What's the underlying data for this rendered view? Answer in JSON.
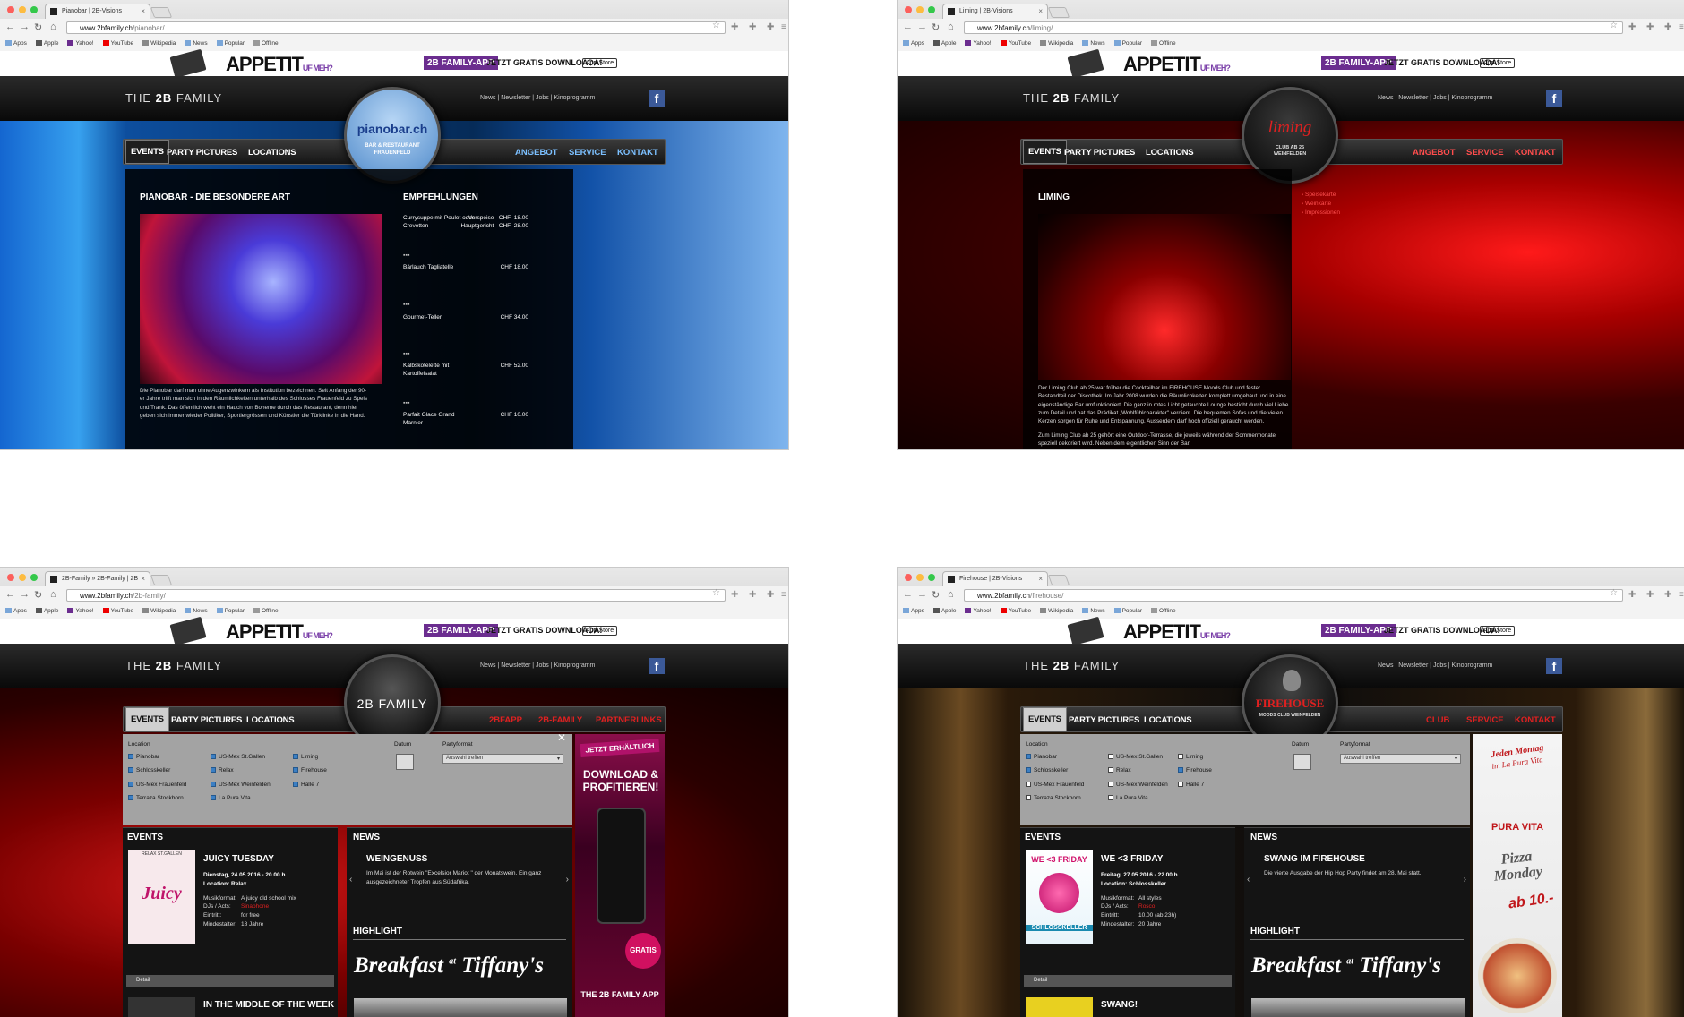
{
  "browser": {
    "bookmarks": [
      "Apps",
      "Apple",
      "Yahoo!",
      "YouTube",
      "Wikipedia",
      "News",
      "Popular",
      "Offline"
    ]
  },
  "banner": {
    "appetit": "APPETIT",
    "appetit_tail": "UF MEH?",
    "app_badge": "2B FAMILY-APP",
    "gratis": "JETZT GRATIS DOWNLOADÄ!",
    "store": "App Store"
  },
  "site": {
    "brand_prefix": "THE ",
    "brand_bold": "2B",
    "brand_suffix": " FAMILY",
    "toplinks": "News | Newsletter | Jobs | Kinoprogramm",
    "fb": "f",
    "menu_left": [
      "EVENTS",
      "PARTY PICTURES",
      "LOCATIONS"
    ]
  },
  "windows": [
    {
      "tab_title": "Pianobar | 2B-Visions",
      "url_host": "www.2bfamily.ch",
      "url_path": "/pianobar/",
      "menu_right": [
        "ANGEBOT",
        "SERVICE",
        "KONTAKT"
      ],
      "logo_main": "pianobar.ch",
      "logo_sub1": "BAR & RESTAURANT",
      "logo_sub2": "FRAUENFELD",
      "title": "PIANOBAR - DIE BESONDERE ART",
      "text": "Die Pianobar darf man ohne Augenzwinkern als Institution bezeichnen. Seit Anfang der 90-er Jahre trifft man sich in den Räumlichkeiten unterhalb des Schlosses Frauenfeld zu Speis und Trank. Das öffentlich weht ein Hauch von Boheme durch das Restaurant, denn hier geben sich immer wieder Politiker, Sportlergrössen und Künstler die Türklinke in die Hand.",
      "sidebar_title": "EMPFEHLUNGEN",
      "dishes": [
        {
          "name": "Currysuppe mit Poulet oder Crevetten",
          "price": "Vorspeise   CHF  18.00\nHauptgericht   CHF  28.00"
        },
        {
          "name": "Bärlauch Tagliatelle",
          "price": "CHF  18.00"
        },
        {
          "name": "Gourmet-Teller",
          "price": "CHF  34.00"
        },
        {
          "name": "Kalbskotelette mit Kartoffelsalat",
          "price": "CHF  52.00"
        },
        {
          "name": "Parfait Glace Grand Marnier",
          "price": "CHF  10.00"
        }
      ]
    },
    {
      "tab_title": "Liming | 2B-Visions",
      "url_host": "www.2bfamily.ch",
      "url_path": "/liming/",
      "menu_right": [
        "ANGEBOT",
        "SERVICE",
        "KONTAKT"
      ],
      "logo_main": "liming",
      "logo_sub1": "CLUB AB 25",
      "logo_sub2": "WEINFELDEN",
      "title": "LIMING",
      "sublinks": [
        "Speisekarte",
        "Weinkarte",
        "Impressionen"
      ],
      "text": "Der Liming Club ab 25 war früher die Cocktailbar im FIREHOUSE Moods Club und fester Bestandteil der Discothek. Im Jahr 2008 wurden die Räumlichkeiten komplett umgebaut und in eine eigenständige Bar umfunktioniert. Die ganz in rotes Licht getauchte Lounge besticht durch viel Liebe zum Detail und hat das Prädikat „Wohlfühlcharakter\" verdient. Die bequemen Sofas und die vielen Kerzen sorgen für Ruhe und Entspannung. Ausserdem darf hoch offiziell geraucht werden.",
      "text2": "Zum Liming Club ab 25 gehört eine Outdoor-Terrasse, die jeweils während der Sommermonate speziell dekoriert wird. Neben dem eigentlichen Sinn der Bar,"
    },
    {
      "tab_title": "2B-Family » 2B-Family | 2B",
      "url_host": "www.2bfamily.ch",
      "url_path": "/2b-family/",
      "menu_right": [
        "2BFAPP",
        "2B-FAMILY",
        "PARTNERLINKS"
      ],
      "logo_main": "2B FAMILY",
      "ad": [
        "JETZT ERHÄLTLICH",
        "DOWNLOAD & PROFITIEREN!",
        "GRATIS",
        "THE 2B FAMILY APP"
      ],
      "event": {
        "title": "JUICY TUESDAY",
        "lines": [
          "Dienstag, 24.05.2016 - 20.00 h",
          "Location: Relax"
        ],
        "rows": [
          [
            "Musikformat:",
            "A juicy old school mix"
          ],
          [
            "DJs / Acts:",
            "Sinaphone"
          ],
          [
            "Eintritt:",
            "for free"
          ],
          [
            "Mindestalter:",
            "18 Jahre"
          ]
        ],
        "poster": "Juicy",
        "poster_top": "RELAX ST.GALLEN"
      },
      "event2": "IN THE MIDDLE OF THE WEEK",
      "news_title": "WEINGENUSS",
      "news_text": "Im Mai ist der Rotwein \"Excelsior Mariot \" der Monatswein. Ein ganz ausgezeichneter Tropfen aus Südafrika."
    },
    {
      "tab_title": "Firehouse | 2B-Visions",
      "url_host": "www.2bfamily.ch",
      "url_path": "/firehouse/",
      "menu_right": [
        "CLUB",
        "SERVICE",
        "KONTAKT"
      ],
      "logo_main": "FIREHOUSE",
      "logo_sub1": "MOODS CLUB WEINFELDEN",
      "ad": [
        "Jeden Montag",
        "im La Pura Vita",
        "PURA VITA",
        "Pizza Monday",
        "ab 10.-"
      ],
      "event": {
        "title": "WE <3 FRIDAY",
        "lines": [
          "Freitag, 27.05.2016 - 22.00 h",
          "Location: Schlosskeller"
        ],
        "rows": [
          [
            "Musikformat:",
            "All styles"
          ],
          [
            "DJs / Acts:",
            "Rosco"
          ],
          [
            "Eintritt:",
            "10.00 (ab 23h)"
          ],
          [
            "Mindestalter:",
            "20 Jahre"
          ]
        ],
        "poster": "WE <3 FRIDAY",
        "poster_top": "SCHLOSSKELLER"
      },
      "event2": "SWANG!",
      "news_title": "SWANG IM FIREHOUSE",
      "news_text": "Die vierte Ausgabe der Hip Hop Party findet am 28. Mai statt."
    }
  ],
  "filter": {
    "location_label": "Location",
    "datum_label": "Datum",
    "partyformat_label": "Partyformat",
    "partyformat_value": "Auswahl treffen",
    "col1": [
      "Pianobar",
      "Schlosskeller",
      "US-Mex Frauenfeld",
      "Terraza Stockborn"
    ],
    "col2": [
      "US-Mex St.Gallen",
      "Relax",
      "US-Mex Weinfelden",
      "La Pura Vita"
    ],
    "col3": [
      "Liming",
      "Firehouse",
      "Halle 7"
    ],
    "checked_w3": [
      true,
      true,
      true,
      true,
      true,
      true,
      true,
      true,
      true,
      true,
      true
    ],
    "checked_w4": [
      true,
      true,
      false,
      false,
      false,
      false,
      false,
      false,
      false,
      true,
      false
    ]
  },
  "labels": {
    "events": "EVENTS",
    "news": "NEWS",
    "highlight": "HIGHLIGHT",
    "detail": "Detail",
    "tiffany_a": "Breakfast",
    "tiffany_b": "at",
    "tiffany_c": "Tiffany's"
  }
}
